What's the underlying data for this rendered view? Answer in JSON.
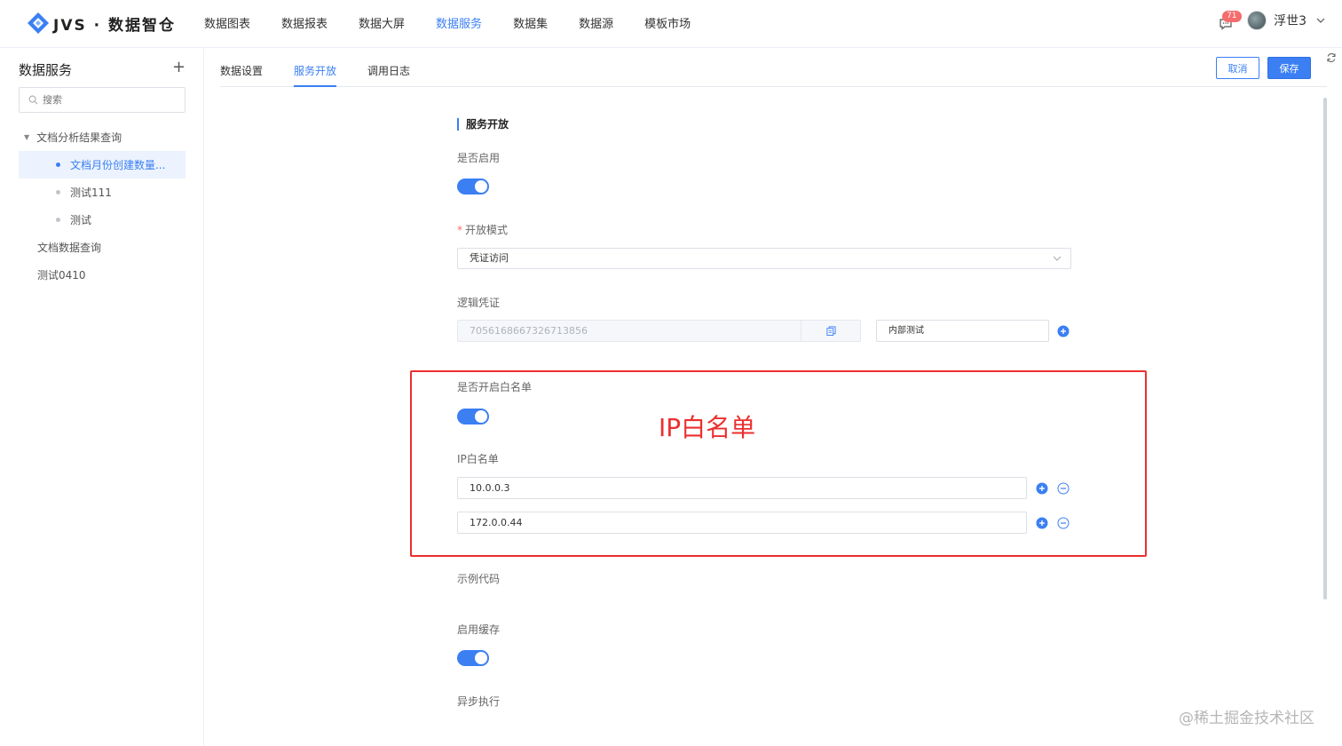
{
  "app": {
    "name": "JVS · 数据智仓",
    "nav": [
      "数据图表",
      "数据报表",
      "数据大屏",
      "数据服务",
      "数据集",
      "数据源",
      "模板市场"
    ],
    "active_nav_index": 3,
    "message_count": "71",
    "username": "浮世3"
  },
  "sidebar": {
    "title": "数据服务",
    "add_label": "+",
    "search_placeholder": "搜索",
    "tree": [
      {
        "label": "文档分析结果查询",
        "level": 0,
        "expanded": true
      },
      {
        "label": "文档月份创建数量...",
        "level": 1,
        "selected": true
      },
      {
        "label": "测试111",
        "level": 1
      },
      {
        "label": "测试",
        "level": 1
      },
      {
        "label": "文档数据查询",
        "level": 0
      },
      {
        "label": "测试0410",
        "level": 0
      }
    ]
  },
  "tabs": [
    "数据设置",
    "服务开放",
    "调用日志"
  ],
  "active_tab_index": 1,
  "actions": {
    "cancel": "取消",
    "save": "保存"
  },
  "form": {
    "section_title": "服务开放",
    "enable_label": "是否启用",
    "enable_on": true,
    "mode_label": "开放模式",
    "mode_required": "*",
    "mode_value": "凭证访问",
    "credential_label": "逻辑凭证",
    "credential_value": "7056168667326713856",
    "credential_name": "内部测试",
    "whitelist_enable_label": "是否开启白名单",
    "whitelist_on": true,
    "ip_label": "IP白名单",
    "ip_list": [
      "10.0.0.3",
      "172.0.0.44"
    ],
    "example_label": "示例代码",
    "cache_label": "启用缓存",
    "cache_on": true,
    "async_label": "异步执行"
  },
  "annotation": "IP白名单",
  "watermark": "@稀土掘金技术社区",
  "colors": {
    "primary": "#3b7ff3",
    "highlight": "#ec2f2f"
  }
}
